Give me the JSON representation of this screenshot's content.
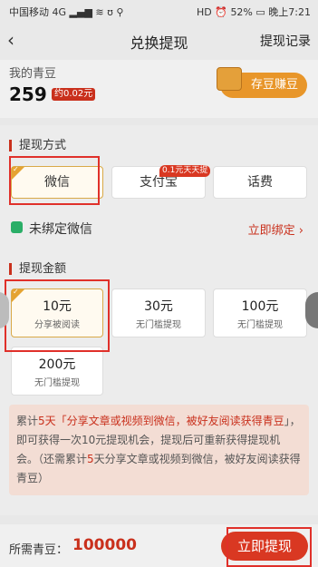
{
  "status": {
    "carrier": "中国移动",
    "signal_icons": "4G ▂▄▆ ≋ ʊ ⚲",
    "hd": "HD",
    "alarm_icon": "⏰",
    "battery_pct": "52%",
    "time": "晚上7:21"
  },
  "nav": {
    "back_icon": "‹",
    "title": "兑换提现",
    "history_link": "提现记录"
  },
  "balance": {
    "label": "我的青豆",
    "value": "259",
    "approx": "约0.02元",
    "store_button": "存豆赚豆"
  },
  "withdraw_method": {
    "title": "提现方式",
    "options": [
      {
        "label": "微信",
        "selected": true
      },
      {
        "label": "支付宝",
        "selected": false,
        "promo": "0.1元天天提"
      },
      {
        "label": "话费",
        "selected": false
      }
    ],
    "bind_text": "未绑定微信",
    "bind_link": "立即绑定 ›"
  },
  "withdraw_amount": {
    "title": "提现金额",
    "amounts": [
      {
        "value": "10元",
        "sub": "分享被阅读",
        "selected": true
      },
      {
        "value": "30元",
        "sub": "无门槛提现",
        "selected": false
      },
      {
        "value": "100元",
        "sub": "无门槛提现",
        "selected": false
      },
      {
        "value": "200元",
        "sub": "无门槛提现",
        "selected": false
      }
    ]
  },
  "notice": {
    "p1": "累计",
    "p2": "5天「",
    "p3": "分享文章或视频到微信，被好友阅读获得青豆",
    "p4": "」，即可获得一次10元提现机会，提现后可重新获得提现机会。（还需累计",
    "p5": "5",
    "p6": "天分享文章或视频到微信，被好友阅读获得青豆）"
  },
  "footer": {
    "need_label": "所需青豆：",
    "need_value": "100000",
    "submit": "立即提现"
  },
  "colors": {
    "accent_red": "#d93822",
    "gold": "#e5a332",
    "wechat_green": "#2aae67"
  }
}
